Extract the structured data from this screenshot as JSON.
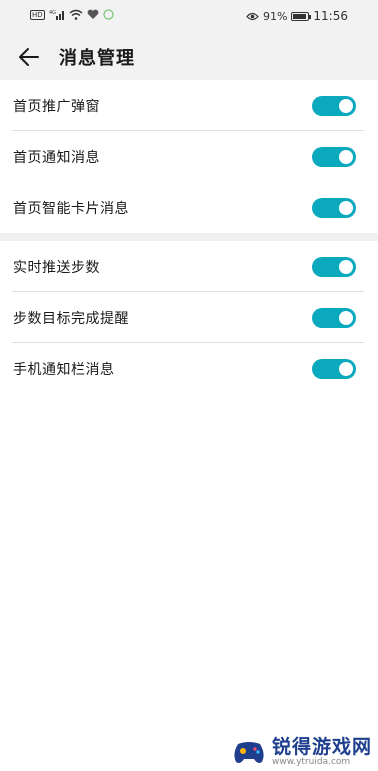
{
  "status_bar": {
    "left_indicators": [
      "HD",
      "4G",
      "signal",
      "wifi",
      "heart",
      "app"
    ],
    "battery_percent": "91%",
    "time": "11:56",
    "battery_level": 0.91
  },
  "header": {
    "title": "消息管理"
  },
  "groups": [
    {
      "items": [
        {
          "label": "首页推广弹窗",
          "on": true
        },
        {
          "label": "首页通知消息",
          "on": true
        },
        {
          "label": "首页智能卡片消息",
          "on": true
        }
      ]
    },
    {
      "items": [
        {
          "label": "实时推送步数",
          "on": true
        },
        {
          "label": "步数目标完成提醒",
          "on": true
        },
        {
          "label": "手机通知栏消息",
          "on": true
        }
      ]
    }
  ],
  "watermark": {
    "name": "锐得游戏网",
    "url": "www.ytruida.com"
  },
  "colors": {
    "accent": "#0aa9bd",
    "header_bg": "#f2f2f2",
    "watermark_blue": "#1f3f8e"
  },
  "icons": {
    "back": "arrow-left-icon",
    "eye": "eye-icon",
    "battery": "battery-icon"
  }
}
